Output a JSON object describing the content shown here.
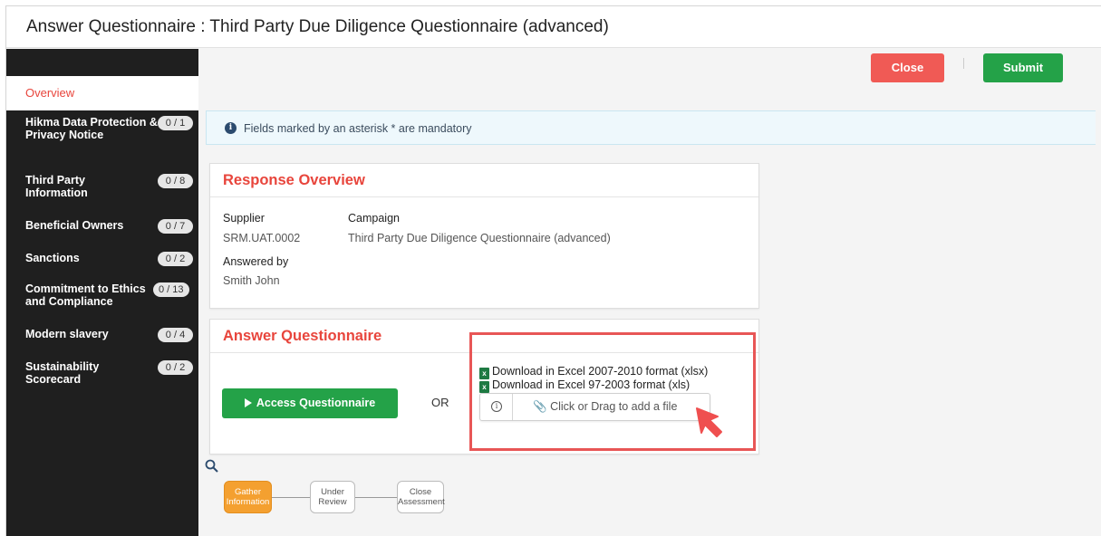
{
  "window": {
    "title": "Answer Questionnaire : Third Party Due Diligence Questionnaire (advanced)"
  },
  "sidebar": {
    "overview_label": "Overview",
    "items": [
      {
        "label": "Hikma Data Protection & Privacy Notice",
        "count": "0 / 1"
      },
      {
        "label": "Third Party Information",
        "count": "0 / 8"
      },
      {
        "label": "Beneficial Owners",
        "count": "0 / 7"
      },
      {
        "label": "Sanctions",
        "count": "0 / 2"
      },
      {
        "label": "Commitment to Ethics and Compliance",
        "count": "0 / 13"
      },
      {
        "label": "Modern slavery",
        "count": "0 / 4"
      },
      {
        "label": "Sustainability Scorecard",
        "count": "0 / 2"
      }
    ]
  },
  "toolbar": {
    "close_label": "Close",
    "submit_label": "Submit"
  },
  "info": {
    "text": "Fields marked by an asterisk * are mandatory"
  },
  "response_overview": {
    "title": "Response Overview",
    "supplier_label": "Supplier",
    "supplier_value": "SRM.UAT.0002",
    "campaign_label": "Campaign",
    "campaign_value": "Third Party Due Diligence Questionnaire (advanced)",
    "answered_by_label": "Answered by",
    "answered_by_value": "Smith John"
  },
  "answer_questionnaire": {
    "title": "Answer Questionnaire",
    "access_label": "Access Questionnaire",
    "or_label": "OR",
    "download_xlsx": "Download in Excel 2007-2010 format (xlsx)",
    "download_xls": "Download in Excel 97-2003 format (xls)",
    "upload_label": "Click or Drag to add a file"
  },
  "workflow": {
    "steps": [
      {
        "label": "Gather Information",
        "state": "active"
      },
      {
        "label": "Under Review",
        "state": "pending"
      },
      {
        "label": "Close Assessment",
        "state": "pending"
      }
    ]
  },
  "colors": {
    "accent_red": "#e8453c",
    "close_button": "#f05a55",
    "submit_button": "#24a248",
    "sidebar_bg": "#1f1f1f",
    "active_step": "#f4a030",
    "highlight_box": "#e85656"
  },
  "icons": {
    "info": "info-circle-icon",
    "excel": "excel-file-icon",
    "attach": "paperclip-icon",
    "search": "search-icon",
    "cursor": "pointer-arrow-icon"
  }
}
